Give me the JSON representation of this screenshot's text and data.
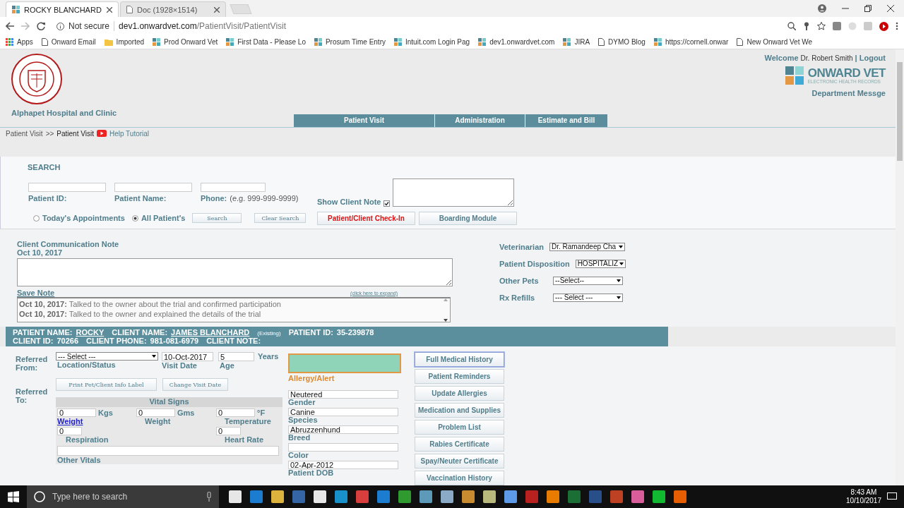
{
  "browser": {
    "tabs": [
      {
        "title": "ROCKY BLANCHARD",
        "selected": true
      },
      {
        "title": "Doc (1928×1514)",
        "selected": false
      }
    ],
    "security": "Not secure",
    "url_host": "dev1.onwardvet.com",
    "url_path": "/PatientVisit/PatientVisit",
    "bookmarks": [
      {
        "label": "Apps",
        "kind": "apps"
      },
      {
        "label": "Onward Email",
        "kind": "page"
      },
      {
        "label": "Imported",
        "kind": "folder"
      },
      {
        "label": "Prod Onward Vet",
        "kind": "site"
      },
      {
        "label": "First Data - Please Lo",
        "kind": "site"
      },
      {
        "label": "Prosum Time Entry",
        "kind": "site"
      },
      {
        "label": "Intuit.com  Login Pag",
        "kind": "site"
      },
      {
        "label": "dev1.onwardvet.com",
        "kind": "site"
      },
      {
        "label": "JIRA",
        "kind": "site"
      },
      {
        "label": "DYMO Blog",
        "kind": "page"
      },
      {
        "label": "https://cornell.onwar",
        "kind": "site"
      },
      {
        "label": "New Onward Vet We",
        "kind": "page"
      }
    ]
  },
  "header": {
    "hospital": "Alphapet Hospital and Clinic",
    "welcome": "Welcome",
    "user": "Dr. Robert Smith",
    "separator": "|",
    "logout": "Logout",
    "brand": "ONWARD VET",
    "brand_sub": "ELECTRONIC HEALTH RECORDS",
    "department": "Department Messge"
  },
  "nav": [
    "Patient Visit",
    "Administration",
    "Estimate and Bill"
  ],
  "breadcrumb": {
    "parent": "Patient Visit",
    "separator": ">>",
    "current": "Patient Visit",
    "help": "Help Tutorial"
  },
  "search": {
    "title": "SEARCH",
    "fields": [
      {
        "label": "Patient ID:"
      },
      {
        "label": "Patient Name:"
      },
      {
        "label": "Phone:",
        "hint": "(e.g. 999-999-9999)"
      }
    ],
    "show_note": {
      "label": "Show Client Note",
      "checked": true
    },
    "radios": [
      {
        "label": "Today's Appointments",
        "selected": false
      },
      {
        "label": "All Patient's",
        "selected": true
      }
    ],
    "buttons": [
      "Search",
      "Clear Search"
    ],
    "checkin": "Patient/Client Check-In",
    "boarding": "Boarding Module"
  },
  "note": {
    "title": "Client Communication Note",
    "date": "Oct 10, 2017",
    "save": "Save Note",
    "expand": "(click here to expand)",
    "entries": [
      {
        "date": "Oct 10, 2017:",
        "text": "Talked to the owner about the trial and confirmed participation"
      },
      {
        "date": "Oct 10, 2017:",
        "text": "Talked to the owner and explained the details of the trial"
      }
    ]
  },
  "selects": [
    {
      "label": "Veterinarian",
      "value": "Dr. Ramandeep Cha"
    },
    {
      "label": "Patient Disposition",
      "value": "HOSPITALIZ"
    },
    {
      "label": "Other Pets",
      "value": "--Select--"
    },
    {
      "label": "Rx Refills",
      "value": "--- Select ---"
    }
  ],
  "patient_bar": [
    [
      {
        "text": "PATIENT NAME:",
        "kind": "label"
      },
      {
        "text": "ROCKY",
        "kind": "link"
      },
      {
        "text": "CLIENT NAME:",
        "kind": "label"
      },
      {
        "text": "JAMES BLANCHARD",
        "kind": "link"
      },
      {
        "text": "(Existing)",
        "kind": "note"
      },
      {
        "text": "PATIENT ID:",
        "kind": "label"
      },
      {
        "text": "35-239878",
        "kind": "value"
      }
    ],
    [
      {
        "text": "CLIENT ID:",
        "kind": "label"
      },
      {
        "text": "70266",
        "kind": "value"
      },
      {
        "text": "CLIENT PHONE:",
        "kind": "label"
      },
      {
        "text": "981-081-6979",
        "kind": "value"
      },
      {
        "text": "CLIENT NOTE:",
        "kind": "label"
      }
    ]
  ],
  "visit": {
    "referred_from": "Referred From:",
    "referred_to": "Referred To:",
    "location": {
      "value": "--- Select ---",
      "label": "Location/Status"
    },
    "date": {
      "value": "10-Oct-2017",
      "label": "Visit Date"
    },
    "age": {
      "value": "5",
      "unit": "Years",
      "label": "Age"
    },
    "buttons": [
      "Print Pet/Client Info Label",
      "Change Visit Date"
    ]
  },
  "vitals": {
    "title": "Vital Signs",
    "fields": [
      {
        "value": "0",
        "unit": "Kgs",
        "label": "Weight",
        "kind": "link"
      },
      {
        "value": "0",
        "unit": "Gms",
        "label": "Weight",
        "kind": "label"
      },
      {
        "value": "0",
        "unit": "°F",
        "label": "Temperature",
        "kind": "label"
      },
      {
        "value": "0",
        "label": "Respiration",
        "kind": "label"
      },
      {
        "value": "0",
        "label": "Heart Rate",
        "kind": "label"
      }
    ],
    "other_label": "Other Vitals"
  },
  "allergy": {
    "label": "Allergy/Alert",
    "color": "#8fd4b8"
  },
  "patient_fields": [
    {
      "value": "Neutered",
      "label": "Gender"
    },
    {
      "value": "Canine",
      "label": "Species"
    },
    {
      "value": "Abruzzenhund",
      "label": "Breed"
    },
    {
      "label": "Color"
    },
    {
      "value": "02-Apr-2012",
      "label": "Patient DOB"
    }
  ],
  "actions": [
    {
      "label": "Full Medical History",
      "focused": true
    },
    {
      "label": "Patient Reminders",
      "focused": false
    },
    {
      "label": "Update Allergies",
      "focused": false
    },
    {
      "label": "Medication and Supplies",
      "focused": false
    },
    {
      "label": "Problem List",
      "focused": false
    },
    {
      "label": "Rabies Certificate",
      "focused": false
    },
    {
      "label": "Spay/Neuter Certificate",
      "focused": false
    },
    {
      "label": "Vaccination History",
      "focused": false
    }
  ],
  "taskbar": {
    "search": "Type here to search",
    "time": "8:43 AM",
    "date": "10/10/2017"
  }
}
